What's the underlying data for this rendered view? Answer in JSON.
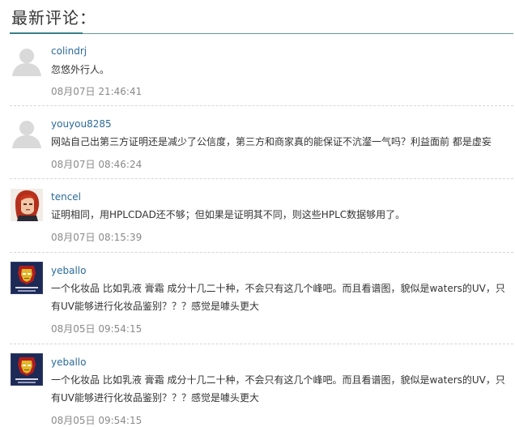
{
  "section": {
    "title": "最新评论："
  },
  "comments": [
    {
      "avatar": "default-user-avatar",
      "username": "colindrj",
      "text": "忽悠外行人。",
      "time": "08月07日 21:46:41"
    },
    {
      "avatar": "default-user-avatar",
      "username": "youyou8285",
      "text": "网站自己出第三方证明还是减少了公信度，第三方和商家真的能保证不沆瀣一气吗？利益面前 都是虚妄",
      "time": "08月07日 08:46:24"
    },
    {
      "avatar": "red-hair-character-avatar",
      "username": "tencel",
      "text": "证明相同，用HPLCDAD还不够；但如果是证明其不同，则这些HPLC数据够用了。",
      "time": "08月07日 08:15:39"
    },
    {
      "avatar": "iron-man-avatar",
      "username": "yeballo",
      "text": "一个化妆品 比如乳液 膏霜 成分十几二十种，不会只有这几个峰吧。而且看谱图，貌似是waters的UV，只有UV能够进行化妆品鉴别？？？感觉是噱头更大",
      "time": "08月05日 09:54:15"
    },
    {
      "avatar": "iron-man-avatar",
      "username": "yeballo",
      "text": "一个化妆品 比如乳液 膏霜 成分十几二十种，不会只有这几个峰吧。而且看谱图，貌似是waters的UV，只有UV能够进行化妆品鉴别？？？感觉是噱头更大",
      "time": "08月05日 09:54:15"
    }
  ]
}
